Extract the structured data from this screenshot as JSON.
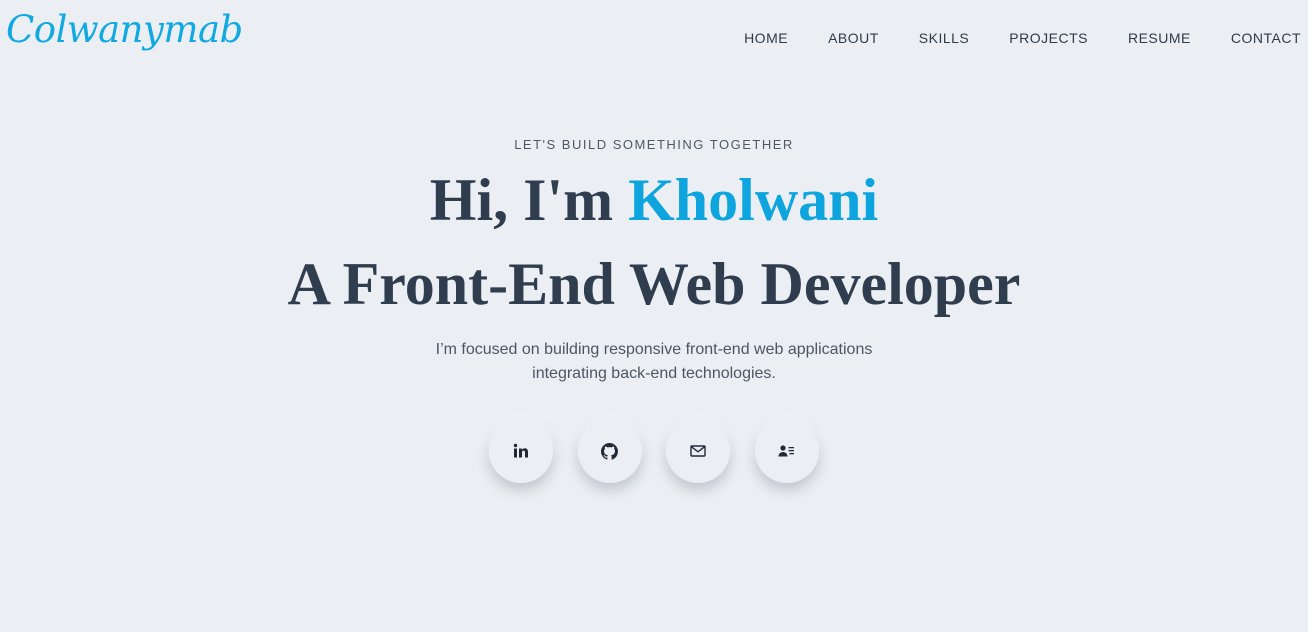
{
  "brand": {
    "logo_text": "Colwanymab",
    "color": "#12a8e0"
  },
  "nav": {
    "items": [
      {
        "label": "HOME"
      },
      {
        "label": "ABOUT"
      },
      {
        "label": "SKILLS"
      },
      {
        "label": "PROJECTS"
      },
      {
        "label": "RESUME"
      },
      {
        "label": "CONTACT"
      }
    ]
  },
  "hero": {
    "eyebrow": "LET'S BUILD SOMETHING TOGETHER",
    "greeting_prefix": "Hi, I'm ",
    "name": "Kholwani",
    "role": "A Front-End Web Developer",
    "blurb_line_1": "I’m focused on building responsive front-end web applications",
    "blurb_line_2": "integrating back-end technologies."
  },
  "socials": [
    {
      "icon": "linkedin-icon"
    },
    {
      "icon": "github-icon"
    },
    {
      "icon": "mail-icon"
    },
    {
      "icon": "contact-card-icon"
    }
  ],
  "colors": {
    "background": "#ebeff3",
    "accent": "#0ea5df",
    "heading": "#2f3d4f"
  }
}
